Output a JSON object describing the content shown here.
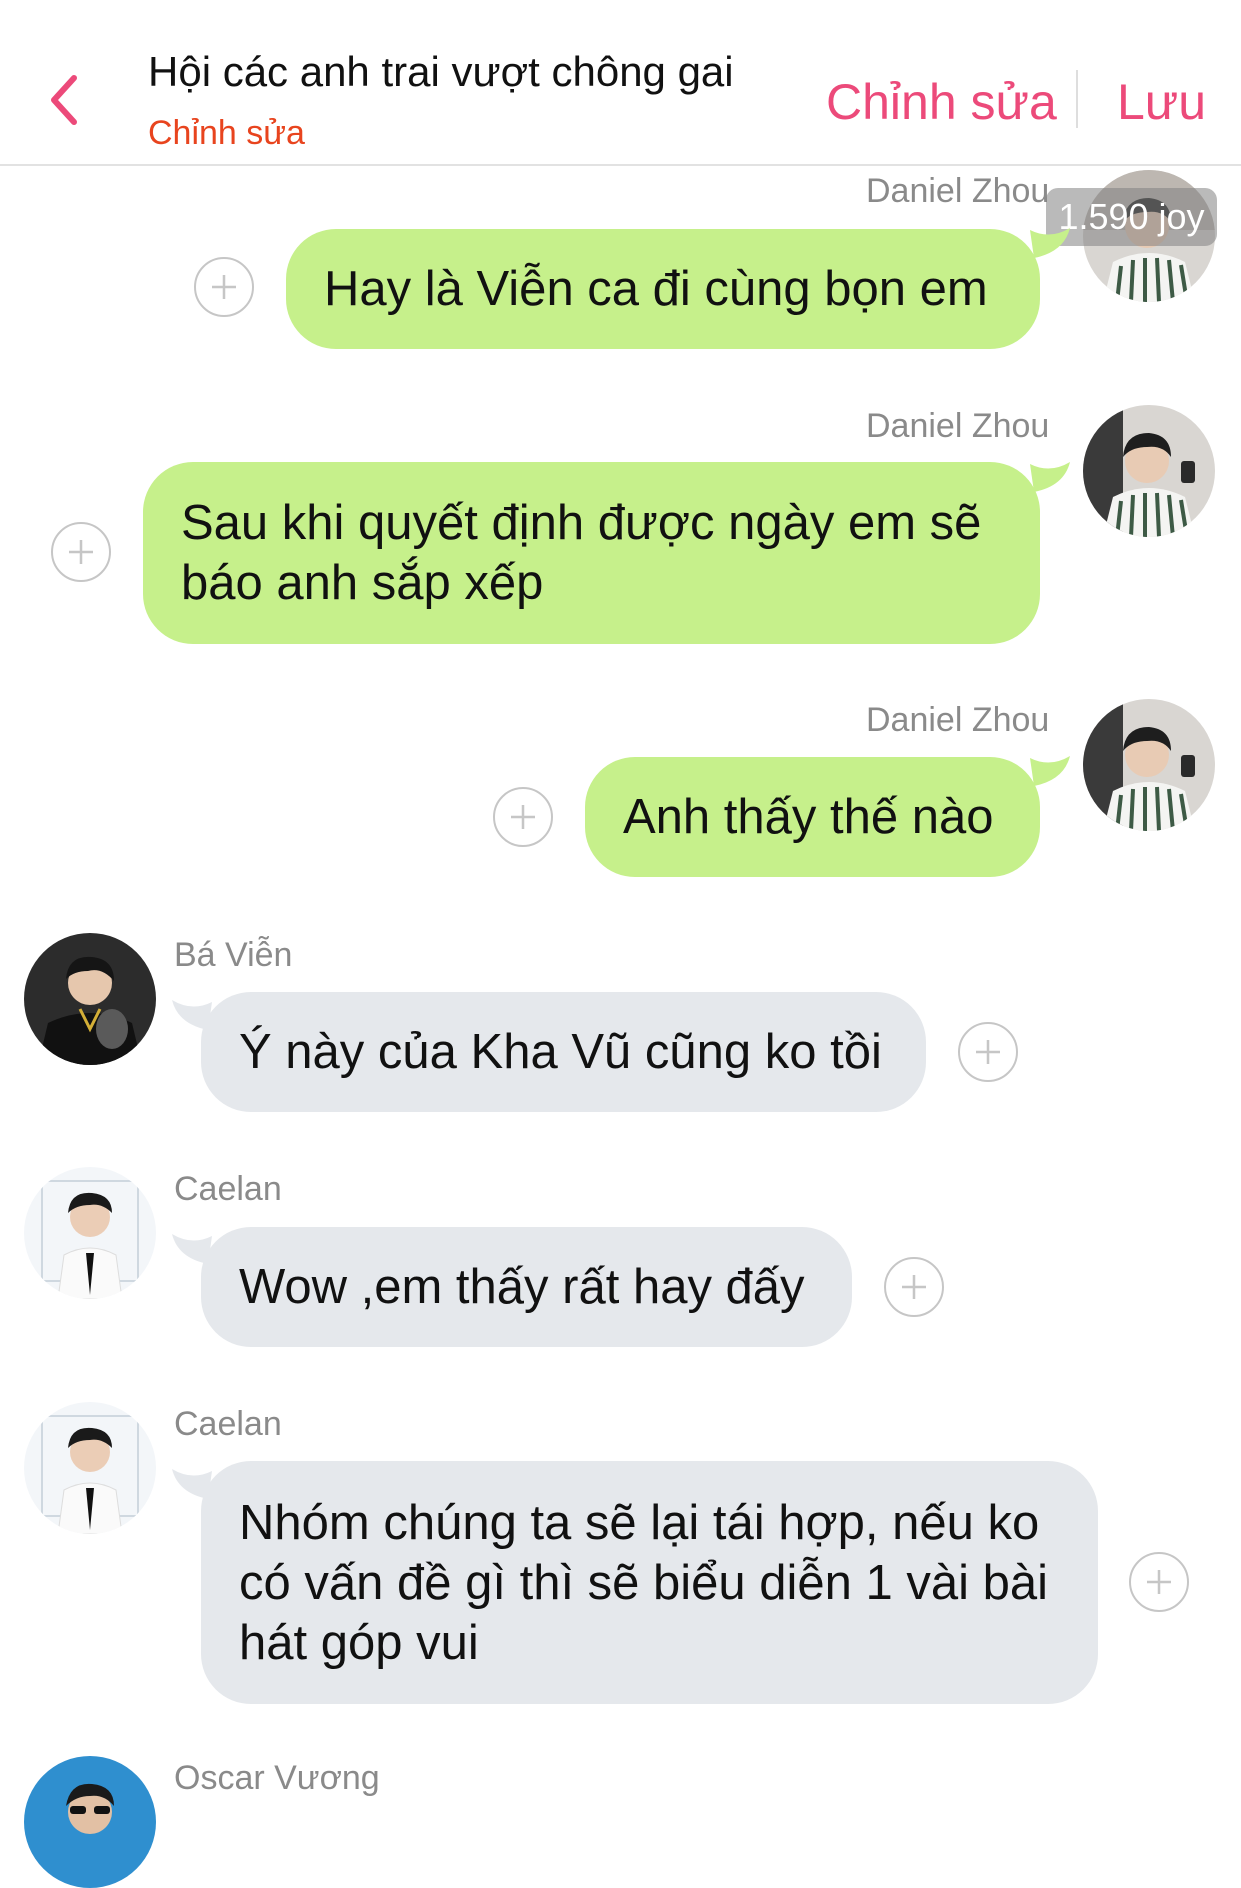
{
  "header": {
    "title": "Hội các anh trai vượt chông gai",
    "subtitle": "Chỉnh sửa",
    "edit_label": "Chỉnh sửa",
    "save_label": "Lưu"
  },
  "badge": {
    "joy": "1.590 joy"
  },
  "messages": [
    {
      "sender": "Daniel Zhou",
      "text": "Hay là Viễn ca đi cùng bọn em",
      "side": "right"
    },
    {
      "sender": "Daniel Zhou",
      "text": "Sau khi quyết định được ngày em sẽ báo anh sắp xếp",
      "side": "right"
    },
    {
      "sender": "Daniel Zhou",
      "text": "Anh thấy thế nào",
      "side": "right"
    },
    {
      "sender": "Bá Viễn",
      "text": "Ý này của Kha Vũ cũng ko tồi",
      "side": "left"
    },
    {
      "sender": "Caelan",
      "text": "Wow ,em thấy rất hay đấy",
      "side": "left"
    },
    {
      "sender": "Caelan",
      "text": "Nhóm chúng ta sẽ lại tái hợp, nếu ko có vấn đề gì thì sẽ biểu diễn 1 vài bài hát góp vui",
      "side": "left"
    },
    {
      "sender": "Oscar Vương",
      "text": "",
      "side": "left"
    }
  ],
  "colors": {
    "accent": "#ec4a7a",
    "subtitle": "#e8441e",
    "bubble_right": "#c6f08b",
    "bubble_left": "#e5e8ec"
  }
}
